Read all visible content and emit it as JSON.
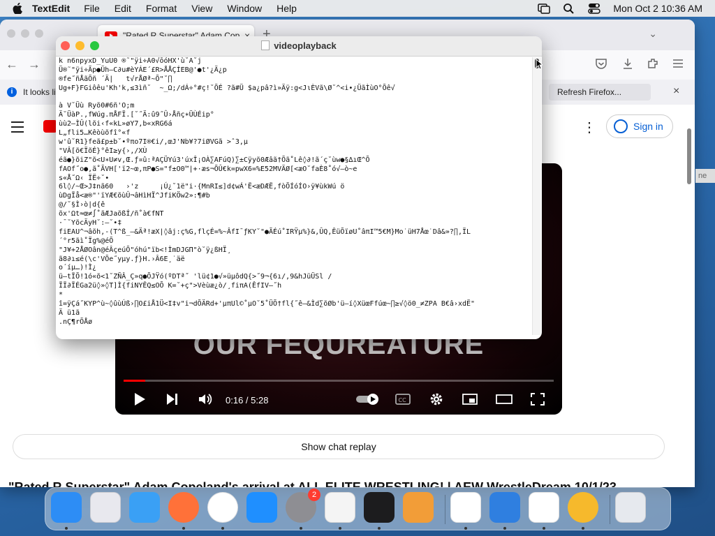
{
  "menubar": {
    "app_name": "TextEdit",
    "items": [
      "File",
      "Edit",
      "Format",
      "View",
      "Window",
      "Help"
    ],
    "clock": "Mon Oct 2  10:36 AM"
  },
  "browser": {
    "tab_title": "\"Rated R Superstar\" Adam Cop",
    "tab_close": "×",
    "new_tab": "+",
    "info_text": "It looks li",
    "refresh_button": "Refresh Firefox...",
    "info_close": "×"
  },
  "youtube": {
    "sign_in": "Sign in",
    "video_overlay_text": "OUR FEQUREATURE",
    "time_display": "0:16 / 5:28",
    "progress_fraction": 0.05,
    "show_chat_replay": "Show chat replay",
    "video_title": "\"Rated R Superstar\" Adam Copeland's arrival at ALL ELITE WRESTLING! | AEW WrestleDream 10/1/23",
    "side_tab_label": "ne"
  },
  "textedit": {
    "title": "videoplayback",
    "lines": [
      "k n6npyxD_YuU0 ®˜\"ÿi÷Â0√ōóHX'ù˘Ä˘j",
      "Ü®˜\"ÿi÷Ãp●Üh—C∂u#èYÁE´£R>ÅÅÇÍEB@'●t'¿Ä¿p",
      "®fe˝ñÅãÕñ ´Ä|   t√rÅØª~Õ\"˘∏",
      "Ug+F}FGiôêu'Kh'k,≤3ìñ˘  ~_Ω;/dÁ÷°#ç!˘ÕÉ ?ã#Ü $a¿pâ?ì»Äÿ:g<JιÈVã\\Ø˘^<i•¿ÜãÌùO°Õê√",
      "",
      "à V˘Üù Ryõ0#6ñ'O;m",
      "Ä˘ÜàP.,fWúg.πÅFÏ.[˘˝Ä:û9˝Û›Åñç∗ÜÙÉip°",
      "ùù2—ÌÛ(lõi‹f«kL»øY7,b«xRG6á",
      "L„fli5…Kêòùõfî°«f",
      "w'û˘R1}feã£p±b˘•ºπo7I®€i/,œJ'Nb¥?7iØVGã >ˆ3,µ",
      "\"VÂ[õ€ÏõÉ}°êI≥y{›,/XÙ",
      "éã●}õiZ\"õ<U∗U≠v,Œ.ƒ¤û:ªAÇÜYú3'úxÎ¡OÀ∑AFúQ)∑±Cÿyõ0Æâã†Õã˚Lê◊∂!ã´ç˘ùw●§∆ıŒ^Õ",
      "fAOf˝o●,ã˚ÃVH['ï2~œ,πP●S=\"f±O0™|+·æs¬ÕÛ€k=pwX6=%E52MVÄØ[<æO˘faÈ8˚ó√–ò~e",
      "s«Å˝Ω‹ ÏË÷˘•",
      "6l◊/~Œ>J‡nã60   ›'z     ¡Ú¿˘1ë\"i·{MnRI≤]d¢wÁ'Ë<æDÆË,fòÕÍóÍO›ÿ¥ùkWú ö",
      "ùDgÏå<æ®\"'ïYÆ€õùÛ¬âHìHÏ^JfiKÖw2»:¶#b",
      "@/˘§Ì›ò|d{ê",
      "õx'Ωt≈œ≠∫˚ãÆJaõßÍ/ñ˚à€fNT",
      "·¯˘YõcÄyH˘:—˘•‡",
      "fiEAU^¬âõh,-(T^ß_–&Äª!æX|◊âj:ç%G,flçÉ=%~ÂfI¯ƒKY˘\"●ÃÉú˚IRŸµ%}&,ÛQ,ÊüÕïøU˚âπI™5€M}Mo˙üH7Åœ˙Dâ&»?∏,ÏL",
      "´°r5ãì˚Ïg%@éÕ",
      "\"J¥+2ÅØOân@éÂçeúÕ\"óhú\"ïb<!ÌmDJGΠ\"ò˘ÿ¿ßHÏ¸",
      "ã8∂ı≤é(\\c'VÕe˝yµy.ƒ}H.›Â6E¸˙äë",
      "o´íµ…)!Ì¿",
      "ü—tÏÕ!1ó«õ<1˘ZÑÂ_Ç»q●ÕJŸó(ºDTª˝ 'lü¢1●√»üµôdQ{>˝9¬{6ı/,9&hJüÜSl /",
      "ÏÏ∂ÏÉGa2ü◊»◊T]Ì{fiNYÊQ≤OÕ K=˘+ç\">Vèùæ¿ò/¸fiπA(ÊfIV—˝h",
      "*",
      "î=ÿÇá˝KYP^ù~◊ûùÚß›∏O£iÅ1Ü<I‡v\"i¬dÕÄRd+'µπUl©˚µO˘5˚ÜÕ†fl{˝ê—&Ìd∑õØb'ü—í◊XüœFfúœ~∏≥√◊ö0_≠ZPA B€â›xdË\"",
      "Ä ü1ã",
      ".nÇ¶rÕÅø"
    ]
  },
  "dock": {
    "apps": [
      {
        "name": "finder",
        "color": "#2d8df5",
        "running": true
      },
      {
        "name": "launchpad",
        "color": "#e8e8ee",
        "running": false
      },
      {
        "name": "safari",
        "color": "#3aa0f5",
        "running": false
      },
      {
        "name": "firefox",
        "color": "#ff7139",
        "running": true
      },
      {
        "name": "chrome",
        "color": "#ffffff",
        "running": true
      },
      {
        "name": "app-store",
        "color": "#1f8fff",
        "running": false
      },
      {
        "name": "system-preferences",
        "color": "#8e8e93",
        "running": true,
        "badge": "2"
      },
      {
        "name": "textedit",
        "color": "#f4f4f4",
        "running": true
      },
      {
        "name": "terminal",
        "color": "#1c1c1e",
        "running": true
      },
      {
        "name": "garageband",
        "color": "#f29d38",
        "running": false
      },
      {
        "name": "vscode",
        "color": "#ffffff",
        "running": true
      },
      {
        "name": "weather",
        "color": "#2f7fe0",
        "running": true
      },
      {
        "name": "parallels",
        "color": "#ffffff",
        "running": true
      },
      {
        "name": "amphetamine",
        "color": "#f6b92c",
        "running": true
      },
      {
        "name": "trash",
        "color": "#e6e9ee",
        "running": false
      }
    ]
  }
}
